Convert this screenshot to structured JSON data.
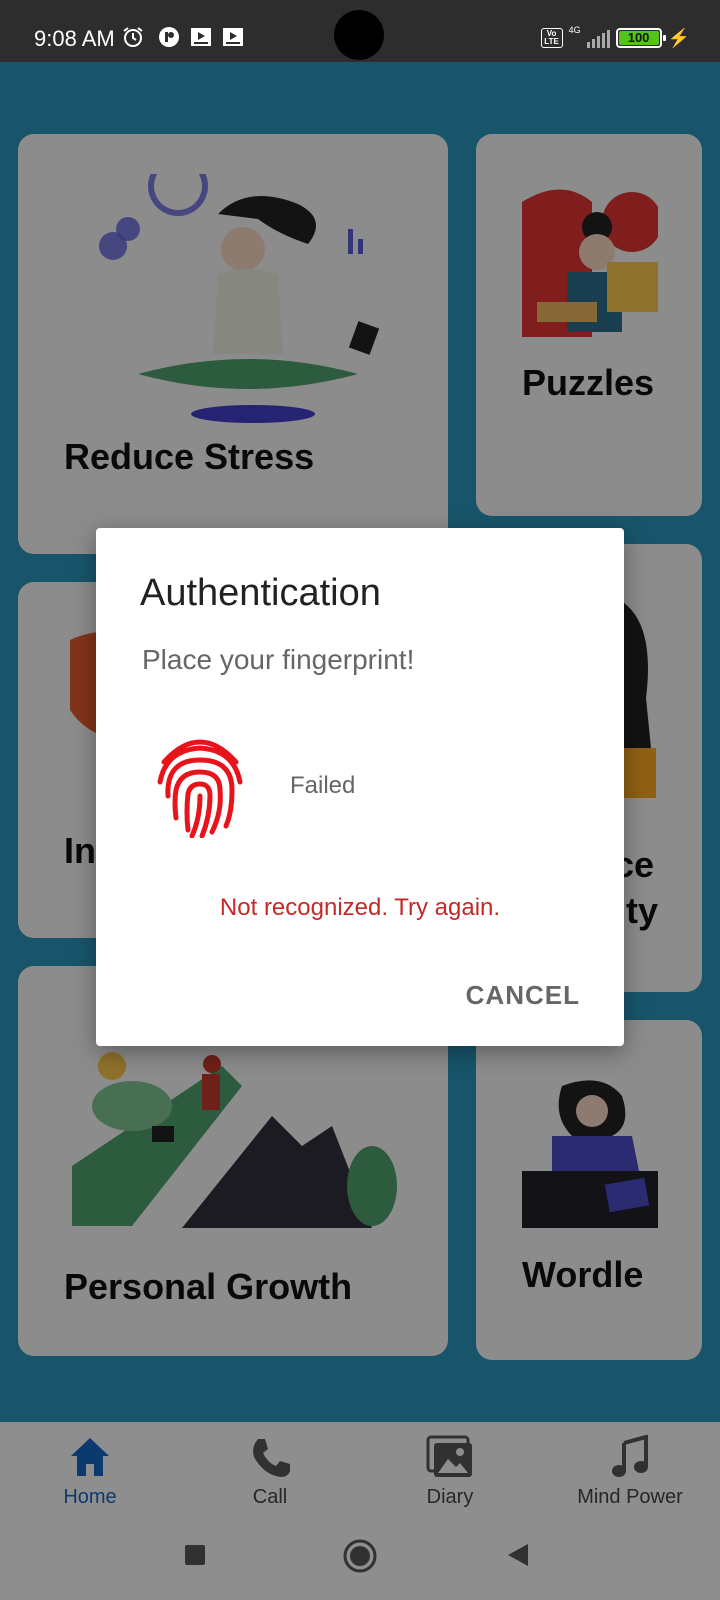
{
  "status_bar": {
    "time": "9:08 AM",
    "network_label": "4G",
    "volte_label": "Vo LTE",
    "battery": "100",
    "icons": [
      "alarm-icon",
      "app-icon",
      "media-icon",
      "media-icon",
      "signal-icon",
      "battery-icon",
      "charging-icon"
    ]
  },
  "cards": [
    {
      "title": "Reduce Stress"
    },
    {
      "title": "Puzzles"
    },
    {
      "title": "In"
    },
    {
      "title": "ce"
    },
    {
      "title": "ty"
    },
    {
      "title": "Personal Growth"
    },
    {
      "title": "Wordle"
    }
  ],
  "bottom_nav": {
    "items": [
      {
        "label": "Home",
        "icon": "home-icon",
        "active": true
      },
      {
        "label": "Call",
        "icon": "phone-icon",
        "active": false
      },
      {
        "label": "Diary",
        "icon": "gallery-icon",
        "active": false
      },
      {
        "label": "Mind Power",
        "icon": "music-note-icon",
        "active": false
      }
    ]
  },
  "dialog": {
    "title": "Authentication",
    "subtitle": "Place your fingerprint!",
    "status": "Failed",
    "error": "Not recognized. Try again.",
    "cancel_label": "CANCEL",
    "fingerprint_color": "#e8141c",
    "error_color": "#c62828"
  },
  "colors": {
    "background": "#2a93b8",
    "active_nav": "#1565c0"
  }
}
